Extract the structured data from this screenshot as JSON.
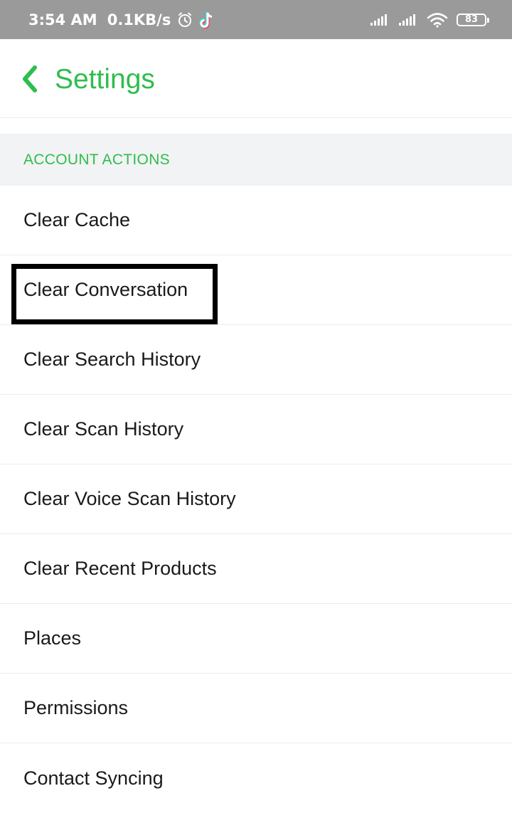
{
  "status_bar": {
    "time": "3:54 AM",
    "speed": "0.1KB/s",
    "battery": "83",
    "icons": [
      "alarm-icon",
      "tiktok-icon",
      "signal-icon",
      "signal-icon",
      "wifi-icon",
      "battery-icon"
    ]
  },
  "header": {
    "title": "Settings",
    "back_icon": "chevron-left-icon"
  },
  "section": {
    "title": "ACCOUNT ACTIONS"
  },
  "items": [
    {
      "label": "Clear Cache"
    },
    {
      "label": "Clear Conversation"
    },
    {
      "label": "Clear Search History"
    },
    {
      "label": "Clear Scan History"
    },
    {
      "label": "Clear Voice Scan History"
    },
    {
      "label": "Clear Recent Products"
    },
    {
      "label": "Places"
    },
    {
      "label": "Permissions"
    },
    {
      "label": "Contact Syncing"
    }
  ],
  "colors": {
    "accent": "#2fbd4e",
    "status_bar": "#9a9a9a",
    "section_bg": "#f2f3f4",
    "text": "#1a1a1a",
    "highlight": "#000000"
  }
}
